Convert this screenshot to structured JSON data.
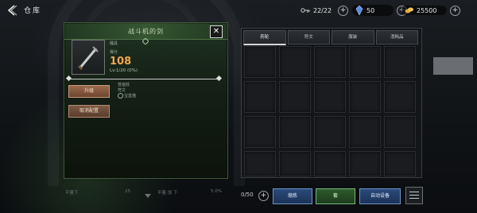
{
  "topbar": {
    "title": "仓库",
    "slots": "22/22",
    "gems": "50",
    "gold": "25500"
  },
  "item_panel": {
    "name": "战斗机的剑",
    "category": "睡具",
    "label_score": "得分",
    "score": "108",
    "level": "Lv:1/20 (0%)",
    "upgrade_label": "升级",
    "cancel_label": "取消配置",
    "options": [
      "普遍效",
      "符文",
      "宝盒描"
    ]
  },
  "under_row": {
    "left": "平量下",
    "mid1": "25",
    "mid2": "平量 加 下",
    "right": "5.0%"
  },
  "inventory": {
    "tabs": [
      "药轮",
      "符文",
      "服装",
      "消耗品"
    ],
    "active_tab": 0,
    "capacity": "0/50"
  },
  "bottom_buttons": {
    "sell": "熔炼",
    "equip": "套",
    "auto": "自动设备"
  },
  "colors": {
    "score": "#f0a64a",
    "panel_green": "#1f3521",
    "button_blue": "#2a4a7a",
    "button_green": "#2d5a2d"
  }
}
